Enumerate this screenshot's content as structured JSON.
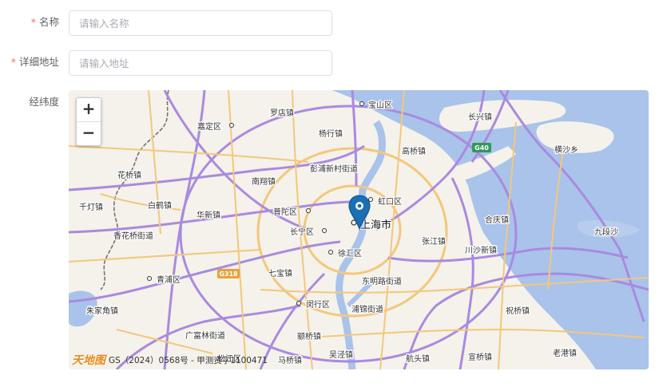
{
  "form": {
    "name": {
      "required_mark": "*",
      "label": "名称",
      "placeholder": "请输入名称",
      "value": ""
    },
    "address": {
      "required_mark": "*",
      "label": "详细地址",
      "placeholder": "请输入地址",
      "value": ""
    },
    "coords": {
      "label": "经纬度"
    }
  },
  "map": {
    "zoom_in": "+",
    "zoom_out": "−",
    "logo_text": "天地图",
    "attribution": "GS（2024）0568号 - 甲测资字1100471",
    "highway_labels": {
      "g40": "G40",
      "g318": "G318"
    },
    "labels": {
      "baoshan": "宝山区",
      "luodian": "罗店镇",
      "jiading": "嘉定区",
      "yanghang": "杨行镇",
      "changxing": "长兴镇",
      "gaoqiao": "高桥镇",
      "hengsha": "横沙乡",
      "huaqiao": "花桥镇",
      "nanxiang": "南翔镇",
      "pengpu": "彭浦新村街道",
      "hongkou": "虹口区",
      "qiandeng": "千灯镇",
      "baihe": "白鹤镇",
      "huaxin": "华新镇",
      "putuo": "普陀区",
      "shanghai": "上海市",
      "hexing": "合庆镇",
      "jiuduansha": "九段沙",
      "xiangqiao": "香花桥街道",
      "changning": "长宁区",
      "zhangjiang": "张江镇",
      "chuansha": "川沙新镇",
      "xuhui": "徐汇区",
      "qibao": "七宝镇",
      "dongming": "东明路街道",
      "qingpu": "青浦区",
      "zhujiajiao": "朱家角镇",
      "minhang": "闵行区",
      "pujin": "浦锦街道",
      "zhuqiao": "祝桥镇",
      "guangfulin": "广富林街道",
      "zhuanqiao": "颛桥镇",
      "songjiang": "松江区",
      "maqiao": "马桥镇",
      "wujing": "吴泾镇",
      "hangtou": "航头镇",
      "xuanqiao": "宣桥镇",
      "laogang": "老港镇"
    }
  }
}
